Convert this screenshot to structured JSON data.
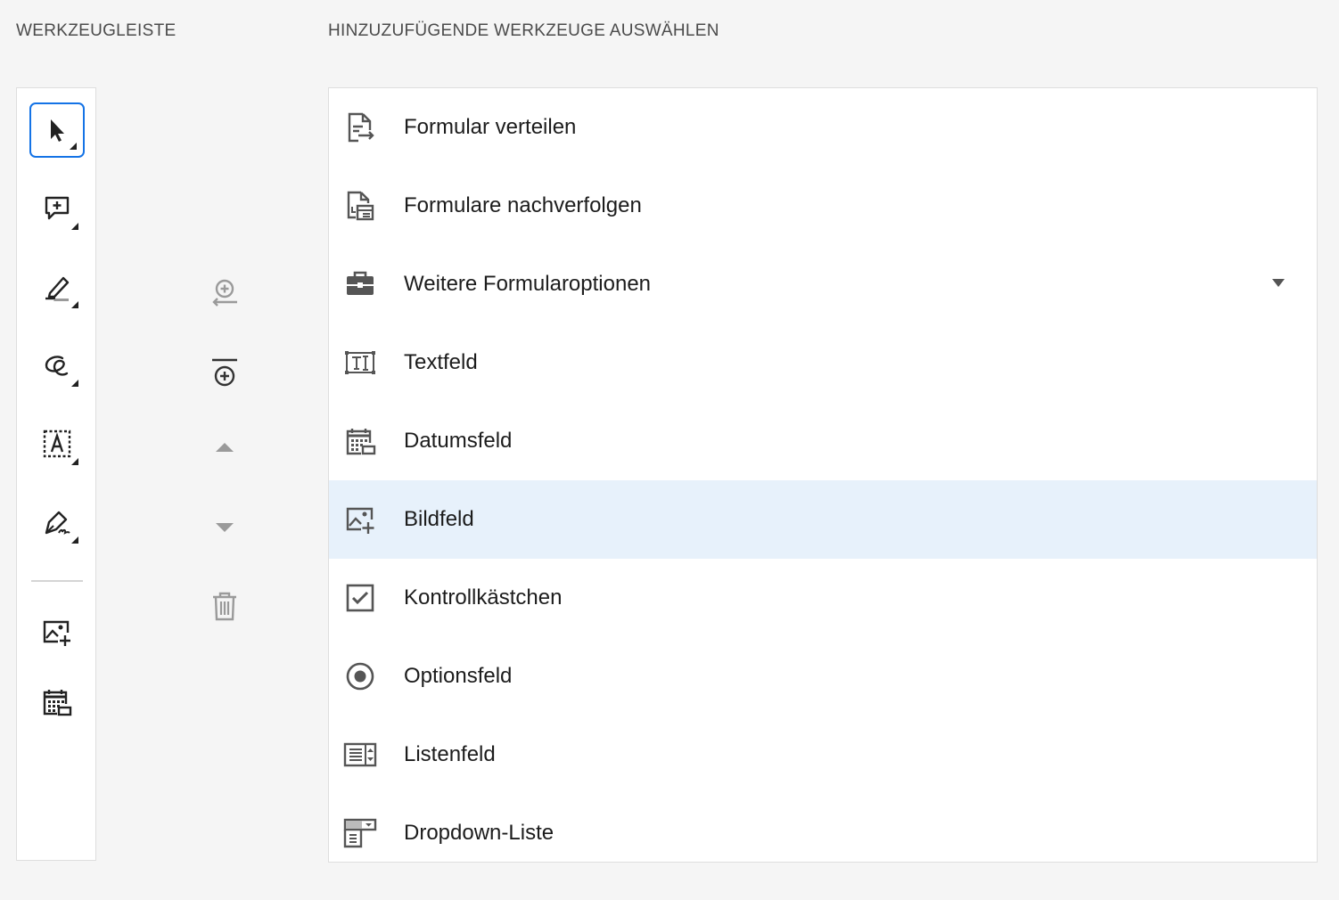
{
  "headers": {
    "toolbar": "WERKZEUGLEISTE",
    "select_tools": "HINZUZUFÜGENDE WERKZEUGE AUSWÄHLEN"
  },
  "toolbar": {
    "tools": [
      {
        "icon": "select-cursor-icon",
        "selected": true
      },
      {
        "icon": "add-comment-icon"
      },
      {
        "icon": "highlight-pen-icon"
      },
      {
        "icon": "lasso-draw-icon"
      },
      {
        "icon": "text-box-icon"
      },
      {
        "icon": "signature-pen-icon"
      },
      {
        "icon": "image-field-icon"
      },
      {
        "icon": "date-field-icon"
      }
    ]
  },
  "actions": [
    {
      "icon": "add-to-toolbar-icon"
    },
    {
      "icon": "add-separator-icon"
    },
    {
      "icon": "move-up-icon"
    },
    {
      "icon": "move-down-icon"
    },
    {
      "icon": "delete-icon"
    }
  ],
  "tool_list": [
    {
      "label": "Formular verteilen",
      "icon": "distribute-form-icon"
    },
    {
      "label": "Formulare nachverfolgen",
      "icon": "track-forms-icon"
    },
    {
      "label": "Weitere Formularoptionen",
      "icon": "briefcase-icon",
      "expandable": true
    },
    {
      "label": "Textfeld",
      "icon": "text-field-icon"
    },
    {
      "label": "Datumsfeld",
      "icon": "date-field-icon"
    },
    {
      "label": "Bildfeld",
      "icon": "image-field-icon",
      "highlighted": true
    },
    {
      "label": "Kontrollkästchen",
      "icon": "checkbox-icon"
    },
    {
      "label": "Optionsfeld",
      "icon": "radio-button-icon"
    },
    {
      "label": "Listenfeld",
      "icon": "list-box-icon"
    },
    {
      "label": "Dropdown-Liste",
      "icon": "dropdown-list-icon"
    }
  ],
  "colors": {
    "accent": "#1473e6",
    "highlight_row": "#e7f1fb",
    "disabled_icon": "#9a9a9a"
  }
}
